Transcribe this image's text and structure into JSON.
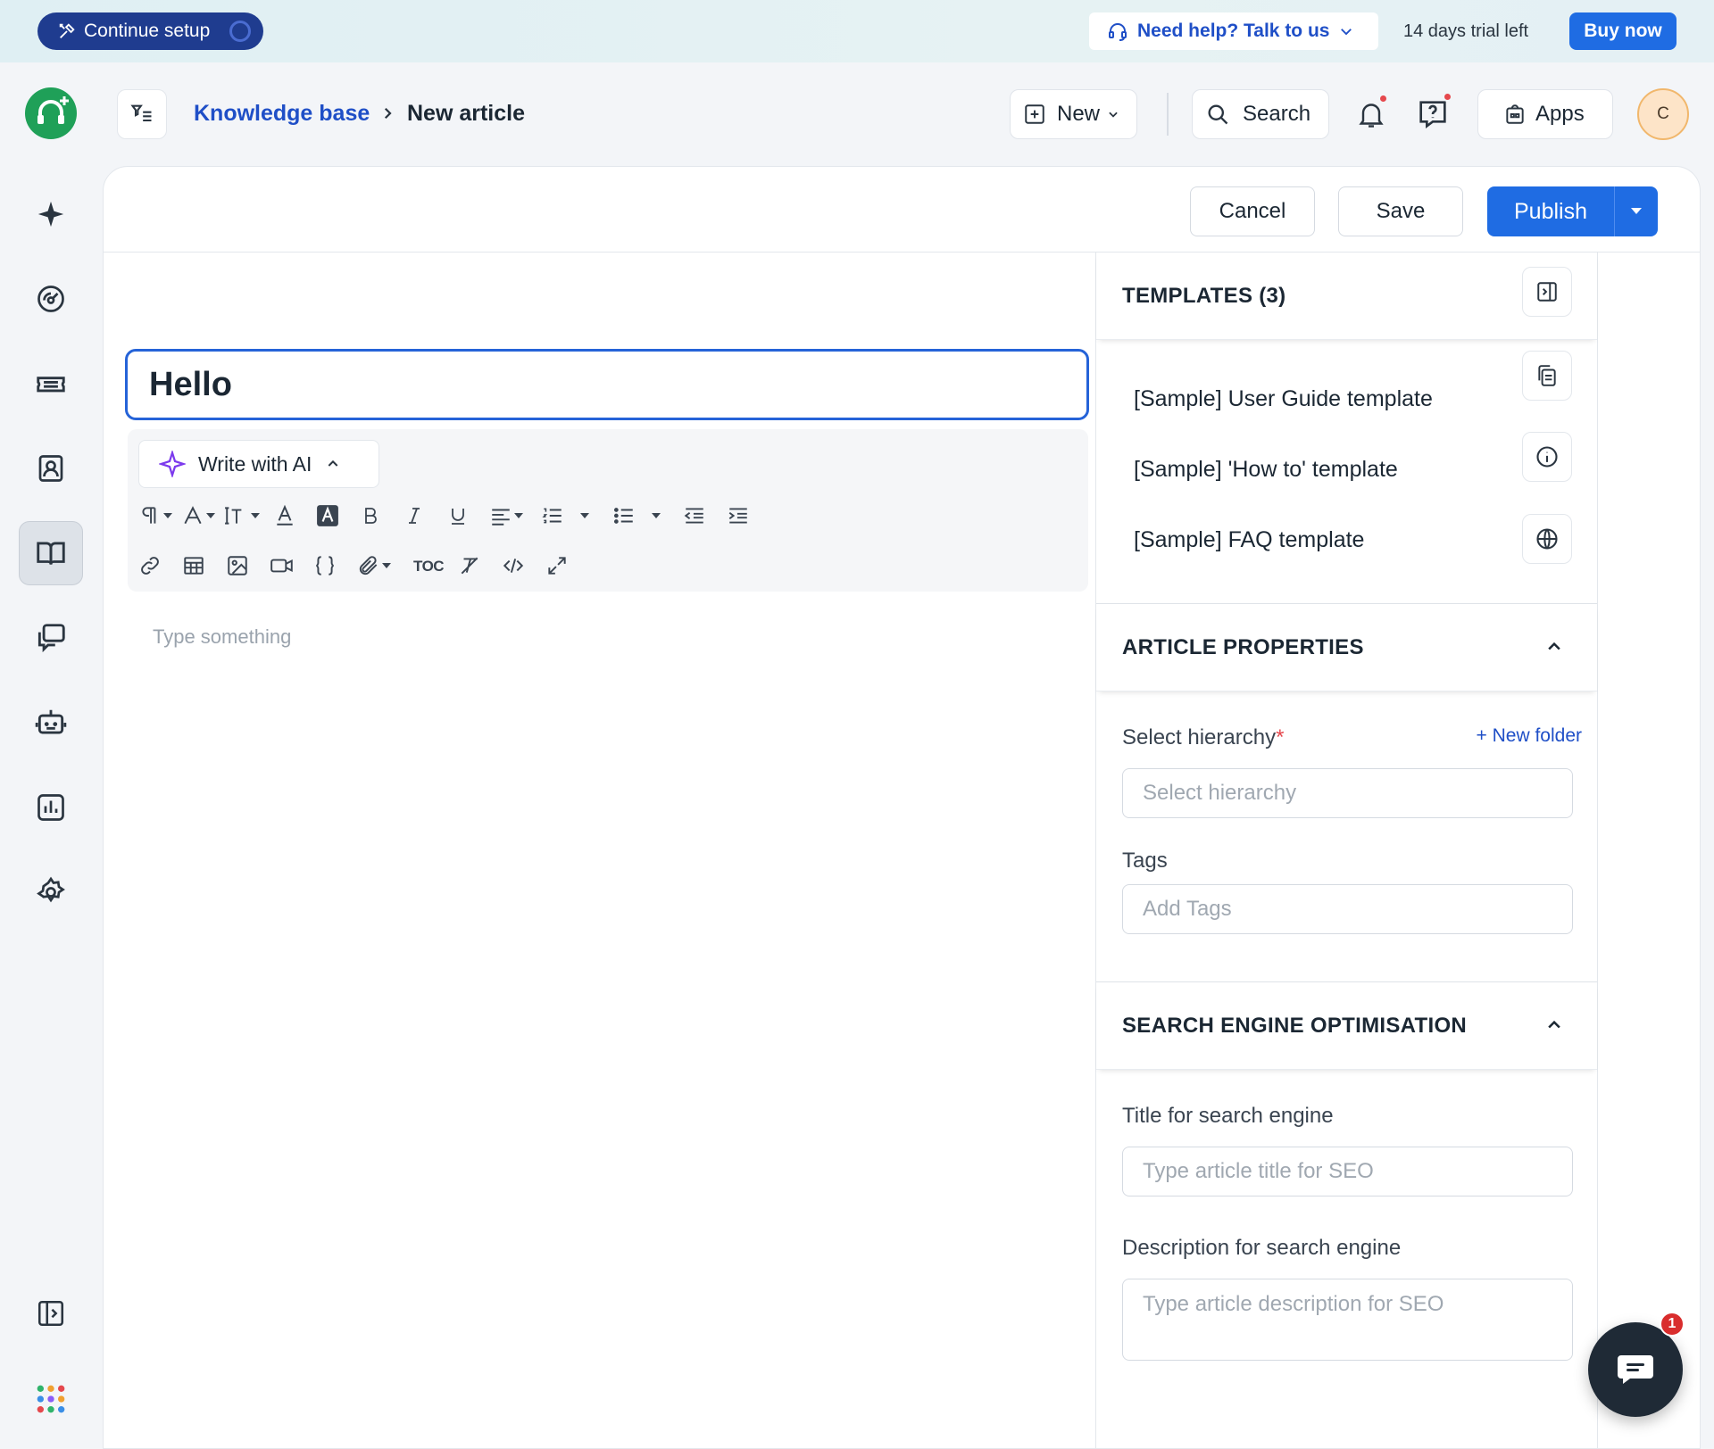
{
  "banner": {
    "setup_label": "Continue setup",
    "help_label": "Need help? Talk to us",
    "trial_text": "14 days trial left",
    "buy_label": "Buy now"
  },
  "header": {
    "breadcrumb_parent": "Knowledge base",
    "breadcrumb_current": "New article",
    "new_label": "New",
    "search_label": "Search",
    "apps_label": "Apps",
    "avatar_initial": "C"
  },
  "rail": {
    "icons": [
      "sparkle-icon",
      "dashboard-icon",
      "ticket-icon",
      "contacts-icon",
      "knowledge-base-icon",
      "conversations-icon",
      "bot-icon",
      "reports-icon",
      "settings-icon",
      "expand-sidebar-icon",
      "apps-grid-icon"
    ],
    "active": "knowledge-base-icon"
  },
  "actions": {
    "cancel_label": "Cancel",
    "save_label": "Save",
    "publish_label": "Publish"
  },
  "editor": {
    "title_value": "Hello",
    "ai_label": "Write with AI",
    "toc_label": "TOC",
    "body_placeholder": "Type something"
  },
  "templates": {
    "header": "TEMPLATES (3)",
    "items": [
      "[Sample] User Guide template",
      "[Sample] 'How to' template",
      "[Sample] FAQ template"
    ]
  },
  "properties": {
    "header": "ARTICLE PROPERTIES",
    "hierarchy_label": "Select hierarchy",
    "required_mark": "*",
    "new_folder_label": "+ New folder",
    "hierarchy_placeholder": "Select hierarchy",
    "tags_label": "Tags",
    "tags_placeholder": "Add Tags"
  },
  "seo": {
    "header": "SEARCH ENGINE OPTIMISATION",
    "title_label": "Title for search engine",
    "title_placeholder": "Type article title for SEO",
    "desc_label": "Description for search engine",
    "desc_placeholder": "Type article description for SEO"
  },
  "chat": {
    "badge_count": "1"
  },
  "colors": {
    "primary": "#1f6ce3",
    "brand_green": "#1fa058",
    "link": "#1f4fc7",
    "danger": "#e5484d"
  }
}
